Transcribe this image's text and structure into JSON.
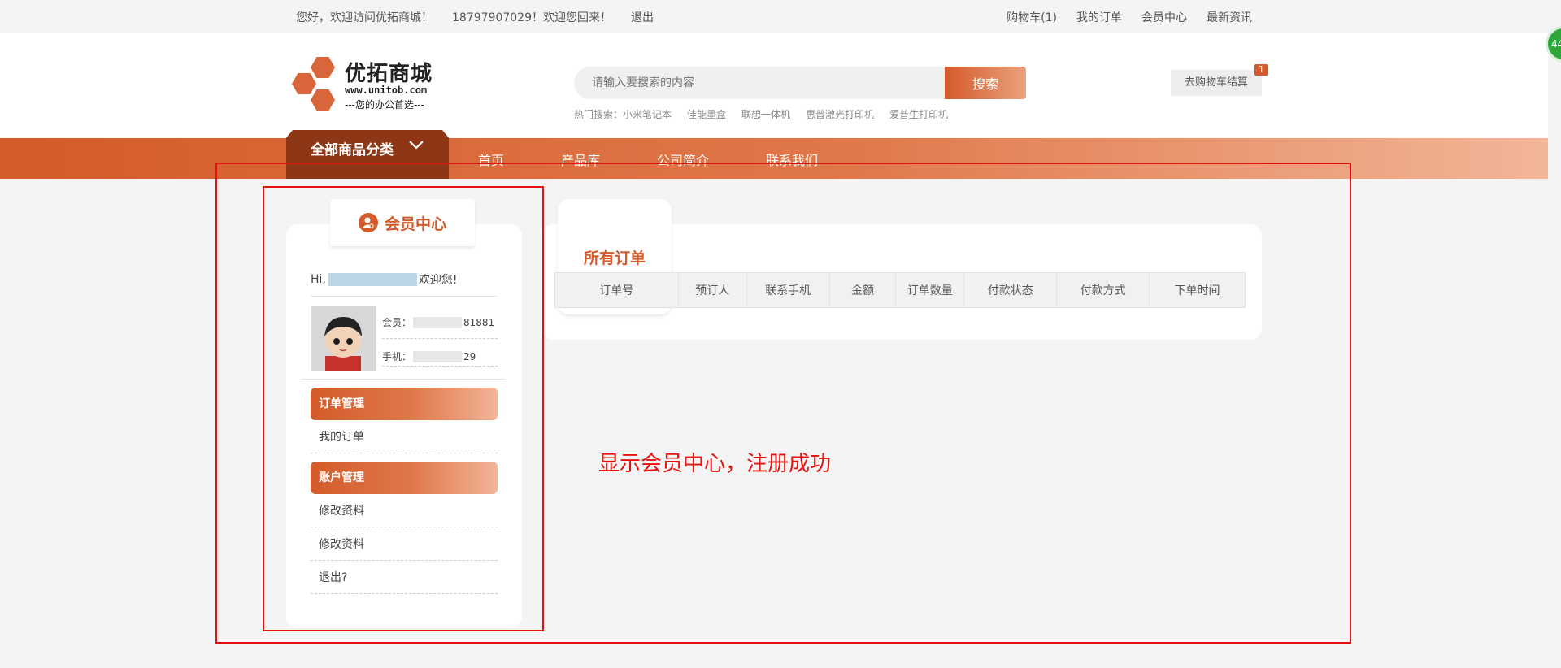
{
  "topbar": {
    "welcome": "您好，欢迎访问优拓商城！",
    "phone_welcome": "18797907029！欢迎您回来！",
    "logout": "退出",
    "cart": "购物车(1)",
    "my_orders": "我的订单",
    "member_center": "会员中心",
    "news": "最新资讯"
  },
  "logo": {
    "name": "优拓商城",
    "url": "www.unitob.com",
    "slogan": "---您的办公首选---"
  },
  "search": {
    "placeholder": "请输入要搜索的内容",
    "button": "搜索",
    "hot_label": "热门搜索：小米笔记本",
    "hot_items": [
      "佳能墨盒",
      "联想一体机",
      "惠普激光打印机",
      "爱普生打印机"
    ]
  },
  "cart": {
    "label": "去购物车结算",
    "count": "1"
  },
  "nav": {
    "categories": "全部商品分类",
    "links": [
      "首页",
      "产品库",
      "公司简介",
      "联系我们"
    ]
  },
  "sidebar": {
    "title": "会员中心",
    "greet_prefix": "Hi,",
    "greet_suffix": "欢迎您!",
    "member_label": "会员：",
    "member_tail": "81881",
    "phone_label": "手机：",
    "phone_tail": "29",
    "group_orders": "订单管理",
    "my_orders": "我的订单",
    "group_account": "账户管理",
    "edit_profile_1": "修改资料",
    "edit_profile_2": "修改资料",
    "logout": "退出?"
  },
  "orders": {
    "title": "所有订单",
    "columns": [
      "订单号",
      "预订人",
      "联系手机",
      "金额",
      "订单数量",
      "付款状态",
      "付款方式",
      "下单时间"
    ]
  },
  "annotation": {
    "note": "显示会员中心，注册成功"
  },
  "bubble": {
    "text": "44"
  },
  "colors": {
    "accent": "#d45b2a",
    "dark_accent": "#8d3717",
    "annotation": "#e8100f"
  }
}
